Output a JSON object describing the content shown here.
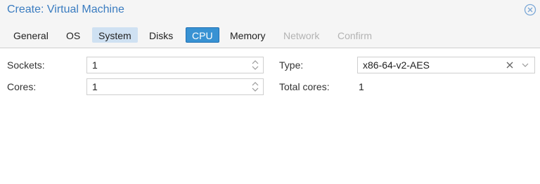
{
  "window": {
    "title": "Create: Virtual Machine"
  },
  "tabs": [
    {
      "label": "General",
      "state": "done"
    },
    {
      "label": "OS",
      "state": "done"
    },
    {
      "label": "System",
      "state": "visited"
    },
    {
      "label": "Disks",
      "state": "done"
    },
    {
      "label": "CPU",
      "state": "active"
    },
    {
      "label": "Memory",
      "state": "done"
    },
    {
      "label": "Network",
      "state": "disabled"
    },
    {
      "label": "Confirm",
      "state": "disabled"
    }
  ],
  "cpu": {
    "sockets_label": "Sockets:",
    "sockets_value": "1",
    "cores_label": "Cores:",
    "cores_value": "1",
    "type_label": "Type:",
    "type_value": "x86-64-v2-AES",
    "total_cores_label": "Total cores:",
    "total_cores_value": "1"
  },
  "icons": {
    "close": "close-circle-icon",
    "spinner": "spinner-updown-icon",
    "clear": "clear-x-icon",
    "dropdown": "chevron-down-icon"
  },
  "colors": {
    "title": "#3a7cc0",
    "active_tab": "#3892d3",
    "visited_tab": "#cfe1f2",
    "disabled_text": "#b3b3b3"
  }
}
